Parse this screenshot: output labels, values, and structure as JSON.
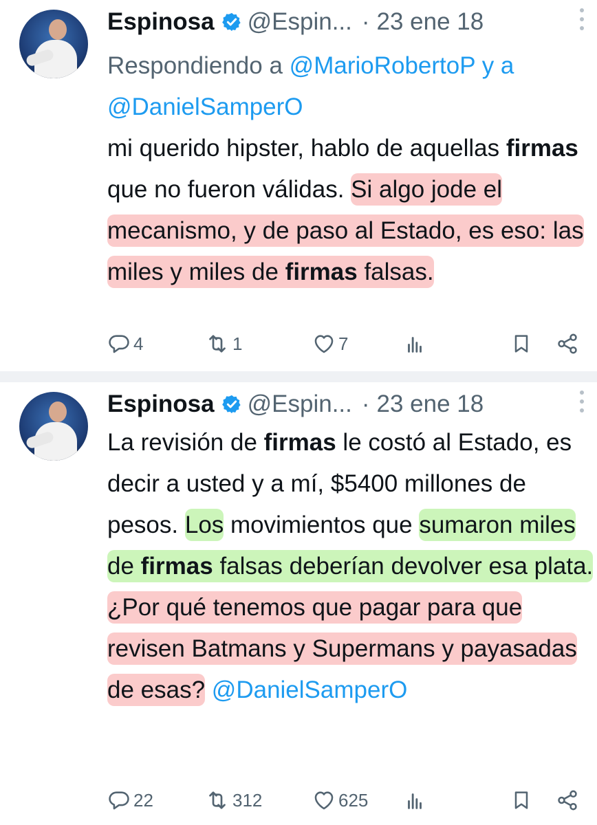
{
  "tweets": [
    {
      "name": "Espinosa",
      "handle": "@Espin...",
      "separator": "·",
      "date": "23 ene 18",
      "reply": {
        "prefix": "Respondiendo a",
        "mention1": "@MarioRobertoP",
        "joiner": "y a",
        "mention2": "@DanielSamperO"
      },
      "text": {
        "s1": "mi querido hipster, hablo de aquellas ",
        "b1": "firmas",
        "s2": " que no fueron válidas. ",
        "h1": "Si algo jode el mecanismo, y de paso al Estado, es eso: las miles y miles de ",
        "h1b": "firmas",
        "h1c": " falsas."
      },
      "stats": {
        "replies": "4",
        "retweets": "1",
        "likes": "7"
      }
    },
    {
      "name": "Espinosa",
      "handle": "@Espin...",
      "separator": "·",
      "date": "23 ene 18",
      "text": {
        "s1": "La revisión de ",
        "b1": "firmas",
        "s2": " le costó al Estado, es decir a usted y a mí, $5400 millones de pesos. ",
        "g1": "Los",
        "s3": " movimientos que ",
        "g2": "sumaron miles de ",
        "g2b": "firmas",
        "g2c": " falsas deberían devolver esa plata.",
        "s4": " ",
        "r1": "¿Por qué tenemos que pagar para que revisen Batmans y Supermans y payasadas de esas?",
        "s5": " ",
        "mention": "@DanielSamperO"
      },
      "stats": {
        "replies": "22",
        "retweets": "312",
        "likes": "625"
      }
    }
  ],
  "colors": {
    "accent": "#1d9bf0",
    "muted": "#536471",
    "highlight_red": "#f8a0a0",
    "highlight_green": "#aaee8c"
  },
  "icons": [
    "verified-badge-icon",
    "more-options-icon",
    "reply-icon",
    "retweet-icon",
    "like-icon",
    "views-icon",
    "bookmark-icon",
    "share-icon"
  ]
}
